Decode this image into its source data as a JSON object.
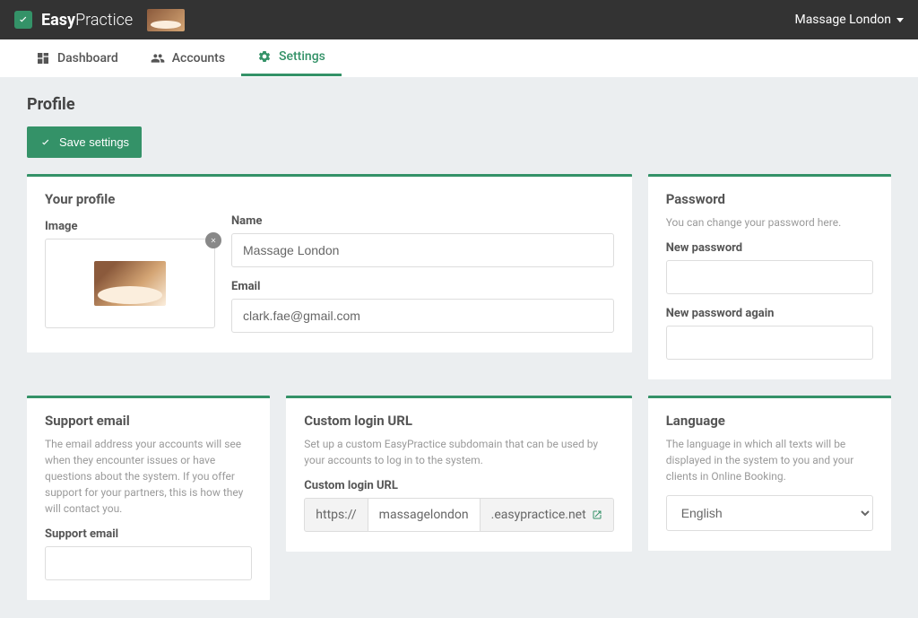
{
  "brand": {
    "bold": "Easy",
    "light": "Practice"
  },
  "account_name": "Massage London",
  "nav": {
    "dashboard": "Dashboard",
    "accounts": "Accounts",
    "settings": "Settings"
  },
  "page": {
    "title": "Profile",
    "save_button": "Save settings"
  },
  "profile_panel": {
    "title": "Your profile",
    "image_label": "Image",
    "name_label": "Name",
    "name_value": "Massage London",
    "email_label": "Email",
    "email_value": "clark.fae@gmail.com"
  },
  "password_panel": {
    "title": "Password",
    "desc": "You can change your password here.",
    "new_label": "New password",
    "again_label": "New password again"
  },
  "support_panel": {
    "title": "Support email",
    "desc": "The email address your accounts will see when they encounter issues or have questions about the system. If you offer support for your partners, this is how they will contact you.",
    "field_label": "Support email"
  },
  "url_panel": {
    "title": "Custom login URL",
    "desc": "Set up a custom EasyPractice subdomain that can be used by your accounts to log in to the system.",
    "field_label": "Custom login URL",
    "protocol": "https://",
    "subdomain": "massagelondon",
    "domain": ".easypractice.net"
  },
  "language_panel": {
    "title": "Language",
    "desc": "The language in which all texts will be displayed in the system to you and your clients in Online Booking.",
    "value": "English"
  }
}
